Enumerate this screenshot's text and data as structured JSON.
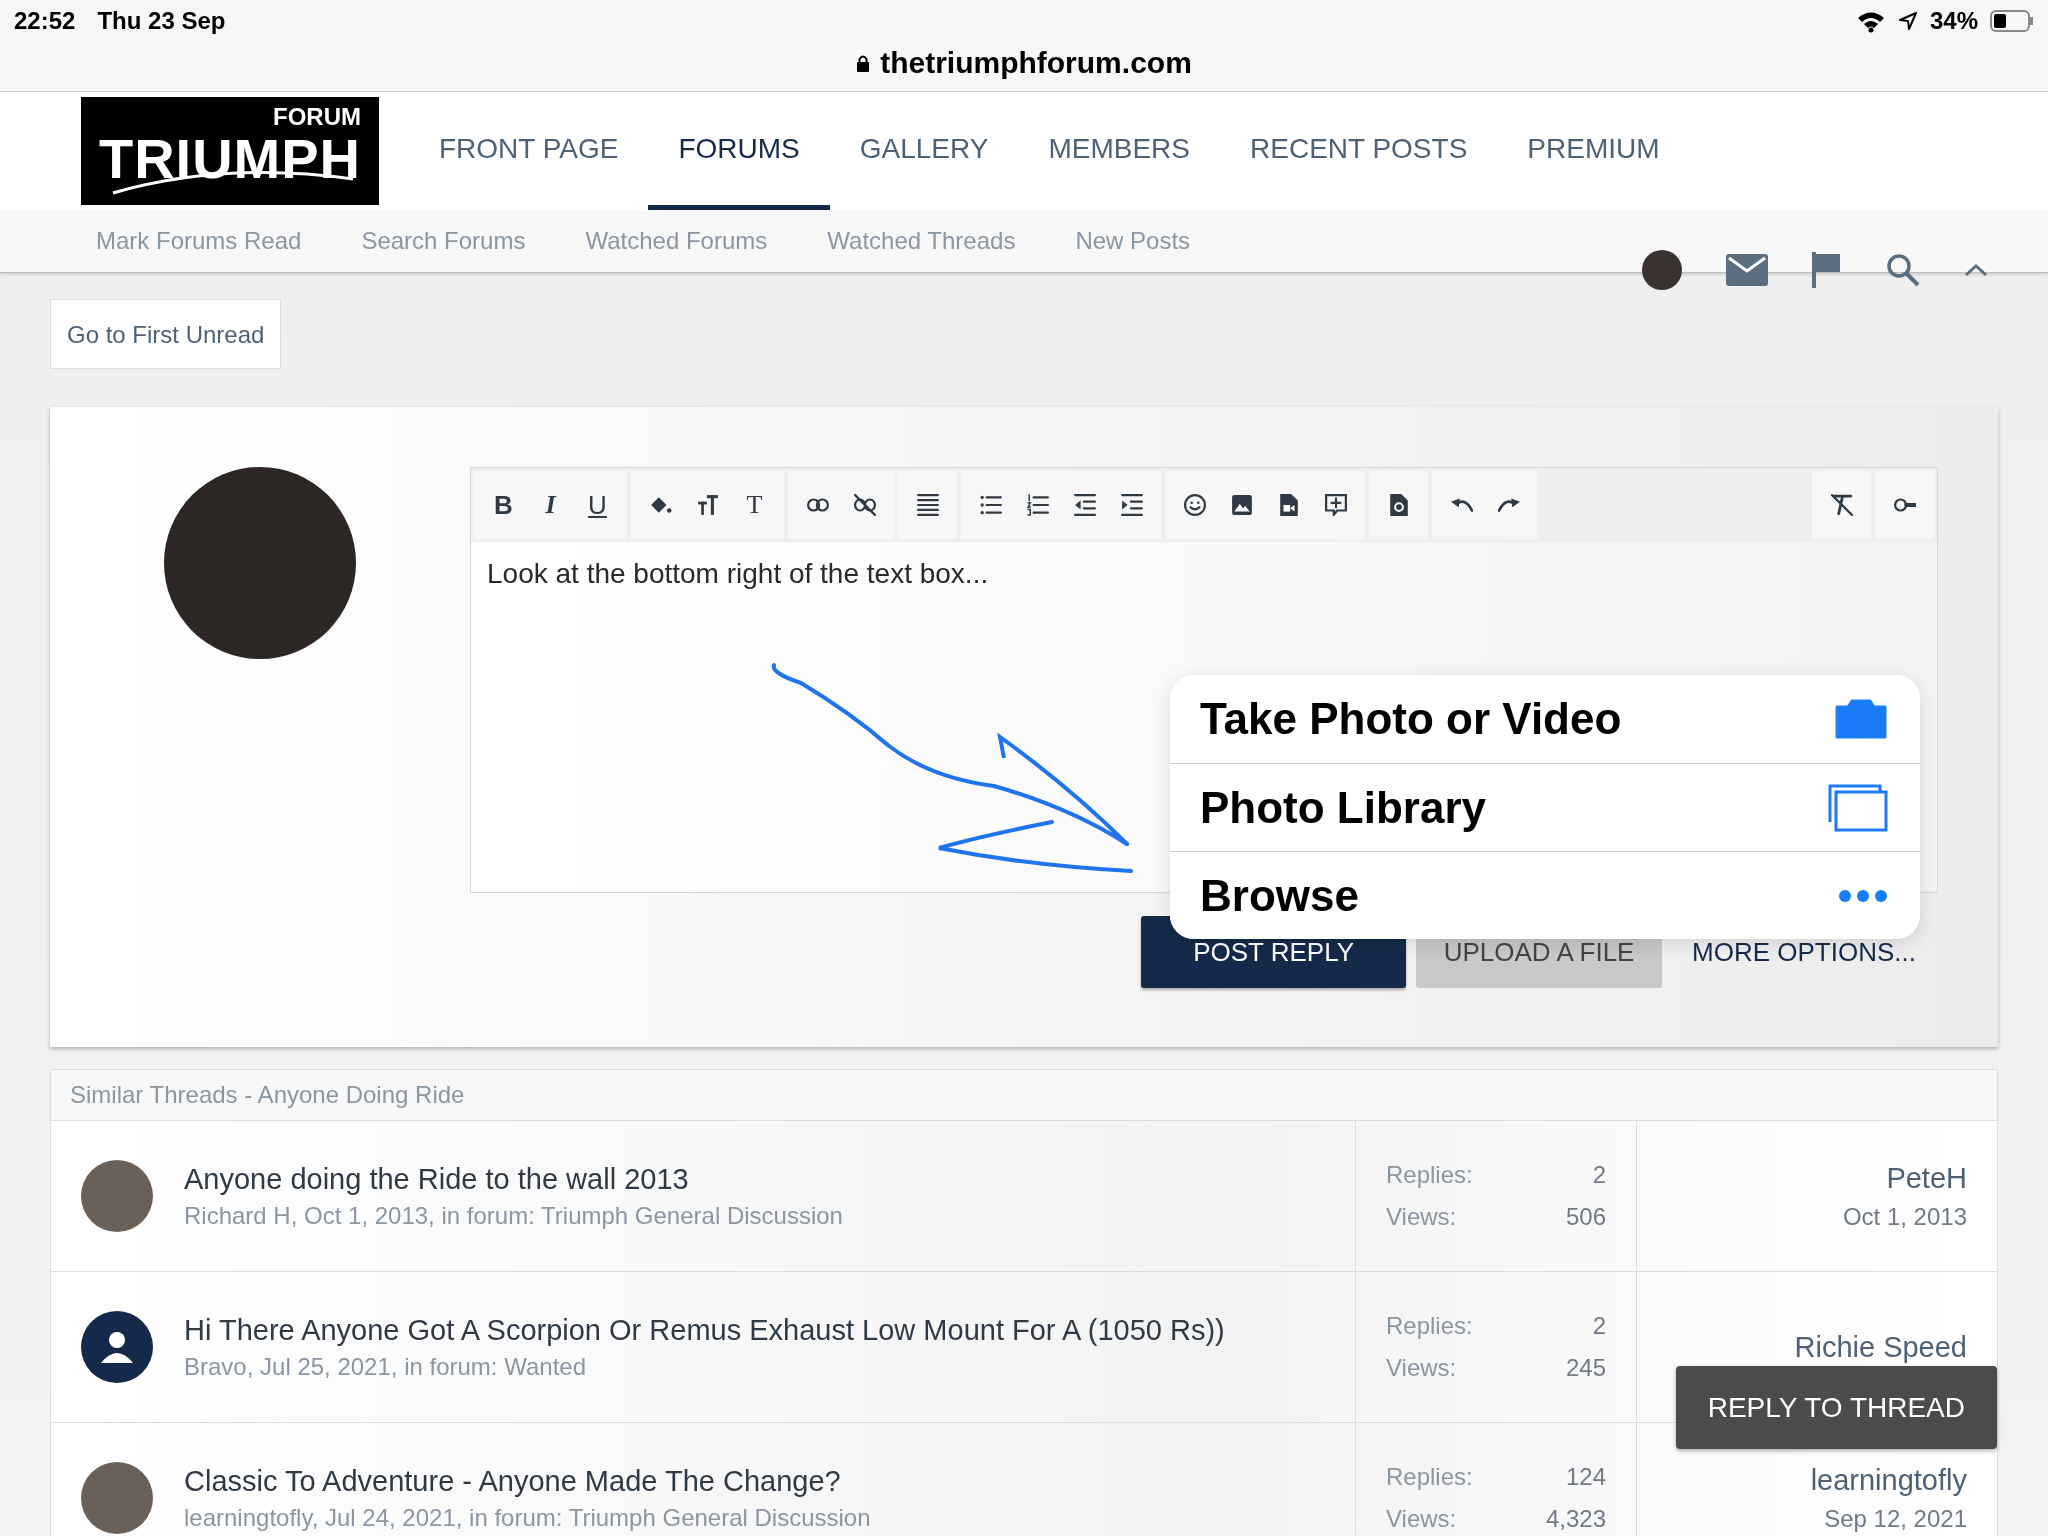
{
  "status_bar": {
    "time": "22:52",
    "date": "Thu 23 Sep",
    "battery": "34%"
  },
  "url": "thetriumphforum.com",
  "logo": {
    "small": "FORUM",
    "big": "TRIUMPH"
  },
  "nav": [
    {
      "label": "FRONT PAGE",
      "selected": false
    },
    {
      "label": "FORUMS",
      "selected": true
    },
    {
      "label": "GALLERY",
      "selected": false
    },
    {
      "label": "MEMBERS",
      "selected": false
    },
    {
      "label": "RECENT POSTS",
      "selected": false
    },
    {
      "label": "PREMIUM",
      "selected": false
    }
  ],
  "subnav": [
    "Mark Forums Read",
    "Search Forums",
    "Watched Forums",
    "Watched Threads",
    "New Posts"
  ],
  "first_unread_button": "Go to First Unread",
  "toolbar": [
    {
      "buttons": [
        {
          "kind": "bold",
          "glyph": "B"
        },
        {
          "kind": "italic",
          "glyph": "I"
        },
        {
          "kind": "underline",
          "glyph": "U"
        }
      ]
    },
    {
      "buttons": [
        {
          "kind": "paint"
        },
        {
          "kind": "text-size"
        },
        {
          "kind": "font",
          "glyph": "T"
        }
      ]
    },
    {
      "buttons": [
        {
          "kind": "link"
        },
        {
          "kind": "unlink"
        }
      ]
    },
    {
      "buttons": [
        {
          "kind": "align"
        }
      ]
    },
    {
      "buttons": [
        {
          "kind": "bullet-list"
        },
        {
          "kind": "numbered-list"
        },
        {
          "kind": "outdent"
        },
        {
          "kind": "indent"
        }
      ]
    },
    {
      "buttons": [
        {
          "kind": "emoji"
        },
        {
          "kind": "image"
        },
        {
          "kind": "video"
        },
        {
          "kind": "comment-plus"
        }
      ]
    },
    {
      "buttons": [
        {
          "kind": "drafts"
        }
      ]
    },
    {
      "buttons": [
        {
          "kind": "undo"
        },
        {
          "kind": "redo"
        }
      ]
    },
    {
      "buttons": [
        {
          "kind": "clear-format"
        }
      ]
    },
    {
      "buttons": [
        {
          "kind": "toggle"
        }
      ]
    }
  ],
  "editor_text": "Look at the bottom right of the text box...",
  "actions": [
    {
      "kind": "primary",
      "label": "POST REPLY"
    },
    {
      "kind": "secondary",
      "label": "UPLOAD A FILE"
    },
    {
      "kind": "link",
      "label": "MORE OPTIONS..."
    }
  ],
  "popover": [
    {
      "kind": "camera",
      "label": "Take Photo or Video"
    },
    {
      "kind": "library",
      "label": "Photo Library"
    },
    {
      "kind": "more",
      "label": "Browse"
    }
  ],
  "similar": {
    "title": "Similar Threads - Anyone Doing Ride",
    "threads": [
      {
        "kind": "photo",
        "title": "Anyone doing the Ride to the wall 2013",
        "meta": "Richard H, Oct 1, 2013, in forum: Triumph General Discussion",
        "replies_label": "Replies:",
        "replies": "2",
        "views_label": "Views:",
        "views": "506",
        "last_user": "PeteH",
        "last_date": "Oct 1, 2013"
      },
      {
        "kind": "generic",
        "title": "Hi There Anyone Got A Scorpion Or Remus Exhaust Low Mount For A (1050 Rs))",
        "meta": "Bravo, Jul 25, 2021, in forum: Wanted",
        "replies_label": "Replies:",
        "replies": "2",
        "views_label": "Views:",
        "views": "245",
        "last_user": "Richie Speed"
      },
      {
        "kind": "photo",
        "title": "Classic To Adventure - Anyone Made The Change?",
        "meta": "learningtofly, Jul 24, 2021, in forum: Triumph General Discussion",
        "replies_label": "Replies:",
        "replies": "124",
        "views_label": "Views:",
        "views": "4,323",
        "last_user": "learningtofly",
        "last_date": "Sep 12, 2021"
      }
    ]
  },
  "reply_to_thread": "REPLY TO THREAD"
}
